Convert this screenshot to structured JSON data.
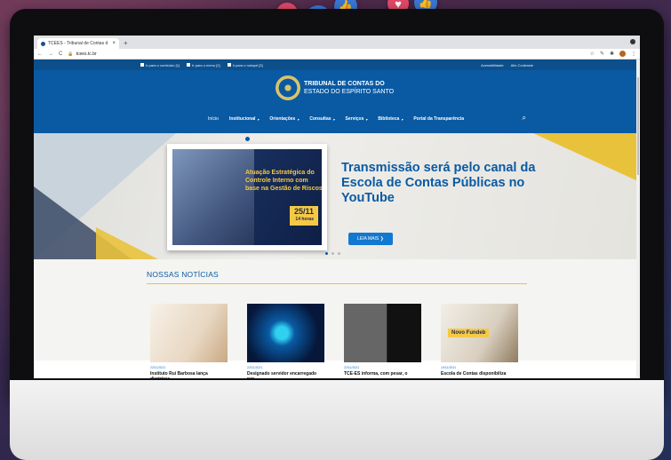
{
  "browser": {
    "tab_title": "TCEES - Tribunal de Contas d",
    "tab_close": "×",
    "new_tab": "+",
    "nav_back": "←",
    "nav_forward": "→",
    "nav_reload": "C",
    "url": "tcees.tc.br"
  },
  "access_bar": {
    "link1": "Ir para o conteúdo [1]",
    "link2": "Ir para o menu [2]",
    "link3": "Ir para o rodapé [3]",
    "accessibility": "Acessibilidade",
    "contrast": "Alto Contraste"
  },
  "site": {
    "logo_line1": "TRIBUNAL DE CONTAS DO",
    "logo_line2": "ESTADO DO ESPÍRITO SANTO",
    "nav": [
      {
        "label": "Início"
      },
      {
        "label": "Institucional"
      },
      {
        "label": "Orientações"
      },
      {
        "label": "Consultas"
      },
      {
        "label": "Serviços"
      },
      {
        "label": "Biblioteca"
      },
      {
        "label": "Portal da Transparência"
      }
    ]
  },
  "hero": {
    "banner_title": "Atuação Estratégica do Controle Interno com base na Gestão de Riscos",
    "banner_date": "25/11",
    "banner_time": "14 horas",
    "headline": "Transmissão será pelo canal da Escola de Contas Públicas no YouTube",
    "button": "LEIA MAIS ❯"
  },
  "news": {
    "section_title": "NOSSAS NOTÍCIAS",
    "items": [
      {
        "date": "22/11/2021",
        "title": "Instituto Rui Barbosa lança diretrizes"
      },
      {
        "date": "22/11/2021",
        "title": "Designado servidor encarregado por"
      },
      {
        "date": "22/11/2021",
        "title": "TCE-ES informa, com pesar, o"
      },
      {
        "date": "19/11/2021",
        "title": "Escola de Contas disponibiliza",
        "tag": "Novo Fundeb"
      }
    ]
  },
  "colors": {
    "brand_blue": "#0a5aa3",
    "gold": "#e9c23c",
    "like": "#3a78d8",
    "heart": "#e64a6a"
  }
}
